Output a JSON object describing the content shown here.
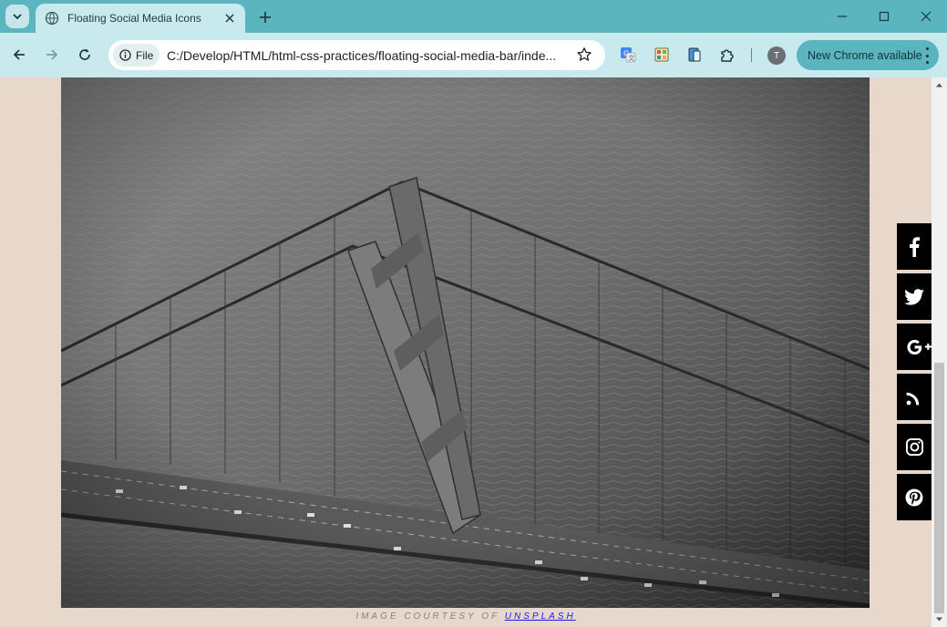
{
  "browser": {
    "tab": {
      "title": "Floating Social Media Icons",
      "favicon": "globe-icon"
    },
    "address": {
      "scheme_label": "File",
      "url": "C:/Develop/HTML/html-css-practices/floating-social-media-bar/inde..."
    },
    "profile_initial": "T",
    "update_label": "New Chrome available"
  },
  "page": {
    "caption_prefix": "IMAGE COURTESY OF ",
    "caption_link": "UNSPLASH",
    "background_color": "#e8d8cc",
    "social_icons": [
      {
        "name": "facebook",
        "icon": "facebook-icon"
      },
      {
        "name": "twitter",
        "icon": "twitter-icon"
      },
      {
        "name": "google-plus",
        "icon": "google-plus-icon"
      },
      {
        "name": "rss",
        "icon": "rss-icon"
      },
      {
        "name": "instagram",
        "icon": "instagram-icon"
      },
      {
        "name": "pinterest",
        "icon": "pinterest-icon"
      }
    ]
  },
  "colors": {
    "chrome_frame": "#5ab5be",
    "toolbar": "#c8e9ed",
    "social_button": "#000000"
  }
}
